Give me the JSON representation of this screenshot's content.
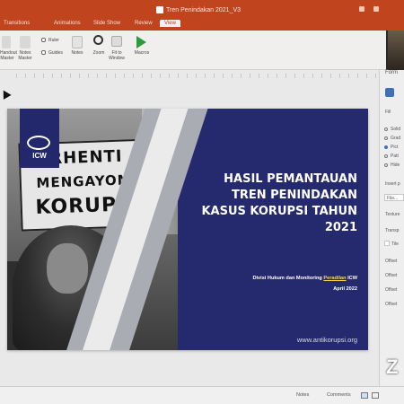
{
  "window": {
    "title": "Tren Penindakan 2021_V3"
  },
  "tabs": [
    {
      "label": "Transitions"
    },
    {
      "label": "Animations"
    },
    {
      "label": "Slide Show"
    },
    {
      "label": "Review"
    },
    {
      "label": "View",
      "active": true
    }
  ],
  "ribbon": {
    "ruler_label": "Ruler",
    "guides_label": "Guides",
    "notes_label": "Notes",
    "zoom_label": "Zoom",
    "fit_label": "Fit to Window",
    "macros_label": "Macros",
    "normal_label": "Notes Master",
    "handout_label": "Handout Master"
  },
  "slide": {
    "sign_line1": "RHENTI",
    "sign_line2": "MENGAYOMI",
    "sign_line3": "KORUPSI",
    "logo_text": "ICW",
    "headline_lines": [
      "HASIL PEMANTAUAN",
      "TREN PENINDAKAN",
      "KASUS KORUPSI TAHUN",
      "2021"
    ],
    "subtitle_prefix": "Divisi Hukum dan Monitoring ",
    "subtitle_highlight": "Peradilan",
    "subtitle_suffix": " ICW",
    "date": "April 2022",
    "url": "www.antikorupsi.org"
  },
  "side_panel": {
    "title": "Form",
    "tab": "Fill",
    "options": [
      "Solid",
      "Grad",
      "Pict",
      "Patt",
      "Hide"
    ],
    "insert_label": "Insert p",
    "file_label": "File...",
    "texture_label": "Texture",
    "transparency_label": "Transp",
    "tile_label": "Tile",
    "offset_labels": [
      "Offset",
      "Offset",
      "Offset",
      "Offset"
    ]
  },
  "statusbar": {
    "notes": "Notes",
    "comments": "Comments"
  },
  "overlay": {
    "zoom_mark": "Z"
  },
  "colors": {
    "titlebar": "#c0441e",
    "slide_bg": "#252a6e",
    "accent": "#ffd54a"
  }
}
